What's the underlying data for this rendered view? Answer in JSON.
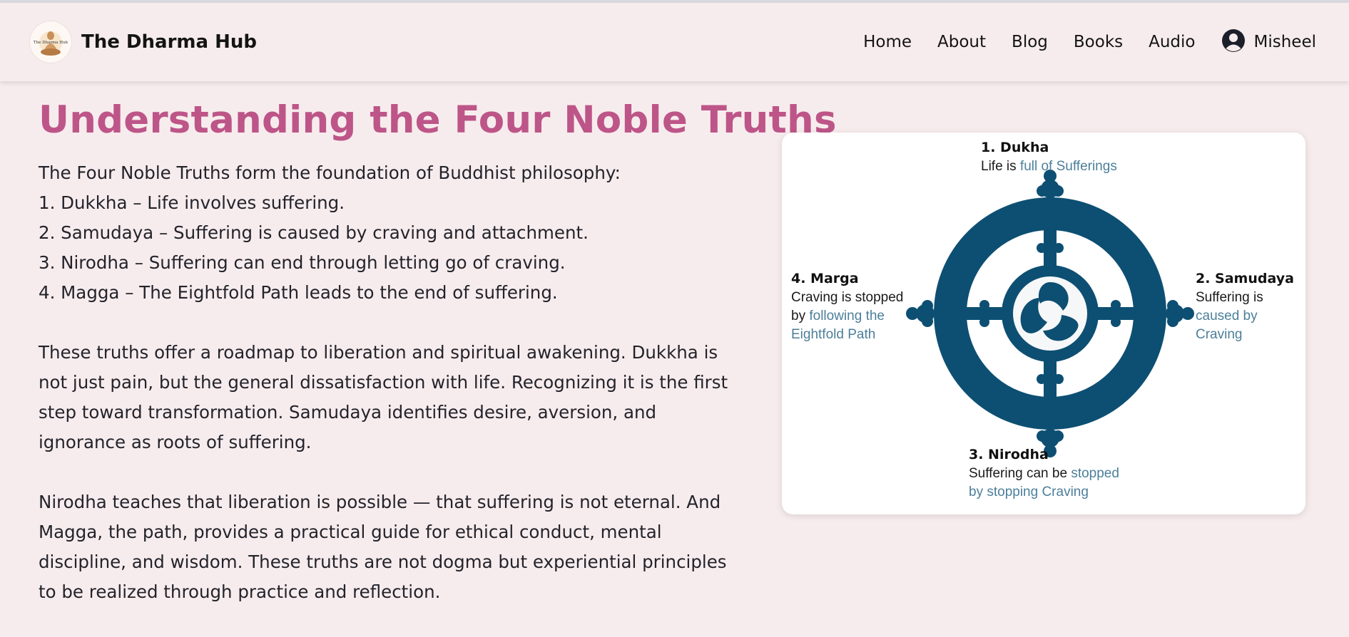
{
  "header": {
    "brand": "The Dharma Hub",
    "logo_text": "The Dharma Hub",
    "nav": [
      "Home",
      "About",
      "Blog",
      "Books",
      "Audio"
    ],
    "user_name": "Misheel"
  },
  "main": {
    "title": "Understanding the Four Noble Truths",
    "intro_lines": [
      "The Four Noble Truths form the foundation of Buddhist philosophy:",
      "1. Dukkha – Life involves suffering.",
      "2. Samudaya – Suffering is caused by craving and attachment.",
      "3. Nirodha – Suffering can end through letting go of craving.",
      "4. Magga – The Eightfold Path leads to the end of suffering."
    ],
    "paragraph_2": "These truths offer a roadmap to liberation and spiritual awakening. Dukkha is not just pain, but the general dissatisfaction with life. Recognizing it is the first step toward transformation. Samudaya identifies desire, aversion, and ignorance as roots of suffering.",
    "paragraph_3": "Nirodha teaches that liberation is possible — that suffering is not eternal. And Magga, the path, provides a practical guide for ethical conduct, mental discipline, and wisdom. These truths are not dogma but experiential principles to be realized through practice and reflection."
  },
  "diagram": {
    "top": {
      "title": "1. Dukha",
      "text": "Life is ",
      "highlight": "full of Sufferings"
    },
    "right": {
      "title": "2. Samudaya",
      "text": "Suffering is",
      "highlight_1": "caused by",
      "highlight_2": "Craving"
    },
    "bottom": {
      "title": "3. Nirodha",
      "text": "Suffering can be ",
      "highlight_1": "stopped",
      "highlight_2": "by stopping Craving"
    },
    "left": {
      "title": "4. Marga",
      "text_1": "Craving is stopped",
      "text_2": "by ",
      "highlight_1": "following the",
      "highlight_2": "Eightfold Path"
    },
    "wheel_color": "#0d4f72"
  },
  "colors": {
    "background": "#f7eced",
    "title": "#bd5588",
    "highlight_blue": "#4c7f9a"
  },
  "icons": {
    "user": "user-circle-icon",
    "logo": "buddha-logo",
    "wheel": "dharma-wheel"
  }
}
